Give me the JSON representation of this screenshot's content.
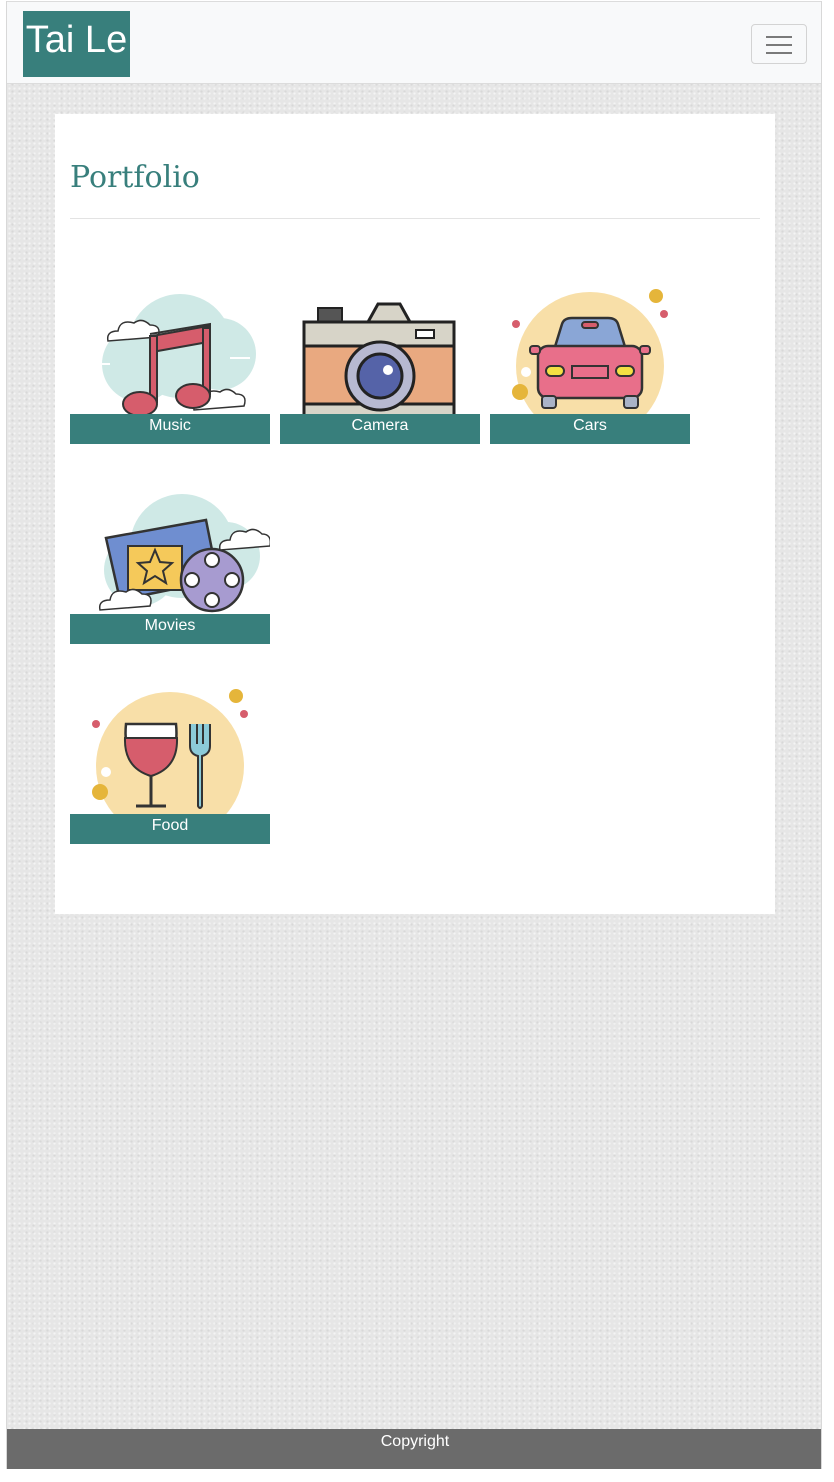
{
  "navbar": {
    "brand": "Tai Le",
    "menu_icon": "hamburger-menu-icon"
  },
  "main": {
    "title": "Portfolio",
    "items": [
      {
        "label": "Music",
        "icon": "music-note-icon"
      },
      {
        "label": "Camera",
        "icon": "camera-icon"
      },
      {
        "label": "Cars",
        "icon": "car-icon"
      },
      {
        "label": "Movies",
        "icon": "movie-ticket-film-reel-icon"
      },
      {
        "label": "Food",
        "icon": "wine-fork-icon"
      }
    ]
  },
  "footer": {
    "text": "Copyright"
  },
  "colors": {
    "accent": "#387f7c",
    "navbar_bg": "#f8f9fa",
    "footer_bg": "#6b6b6b",
    "page_bg": "#e6e6e6"
  }
}
